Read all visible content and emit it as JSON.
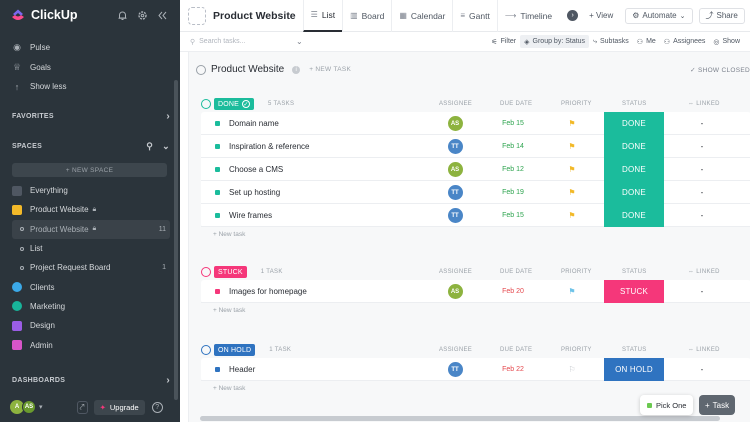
{
  "app": {
    "name": "ClickUp"
  },
  "sidebar": {
    "nav": [
      {
        "label": "Pulse",
        "icon": "pulse-icon"
      },
      {
        "label": "Goals",
        "icon": "trophy-icon"
      },
      {
        "label": "Show less",
        "icon": "arrow-up-icon"
      }
    ],
    "favorites_label": "FAVORITES",
    "spaces_label": "SPACES",
    "new_space_label": "+ NEW SPACE",
    "tree": [
      {
        "label": "Everything",
        "color": "#7c828d",
        "level": 0
      },
      {
        "label": "Product Website",
        "color": "#f2b929",
        "level": 0,
        "locked": true
      },
      {
        "label": "Product Website",
        "level": 1,
        "count": "11",
        "active": true,
        "locked": true
      },
      {
        "label": "List",
        "level": 1
      },
      {
        "label": "Project Request Board",
        "level": 1,
        "count": "1"
      },
      {
        "label": "Clients",
        "color": "#3ba9e8",
        "level": 0
      },
      {
        "label": "Marketing",
        "color": "#18b49a",
        "level": 0
      },
      {
        "label": "Design",
        "color": "#9b5de5",
        "level": 0
      },
      {
        "label": "Admin",
        "color": "#d855c9",
        "level": 0
      }
    ],
    "dashboards_label": "DASHBOARDS",
    "user_initials": [
      "A",
      "AS"
    ],
    "upgrade_label": "Upgrade"
  },
  "topbar": {
    "page_title": "Product Website",
    "views": [
      "List",
      "Board",
      "Calendar",
      "Gantt",
      "Timeline"
    ],
    "active_view": "List",
    "add_view_label": "+ View",
    "automate_label": "Automate",
    "share_label": "Share"
  },
  "filterbar": {
    "search_placeholder": "Search tasks...",
    "filter_label": "Filter",
    "groupby_label": "Group by: Status",
    "subtasks_label": "Subtasks",
    "me_label": "Me",
    "assignees_label": "Assignees",
    "show_label": "Show"
  },
  "list": {
    "title": "Product Website",
    "new_task_label": "+ NEW TASK",
    "show_closed_label": "SHOW CLOSED",
    "columns": {
      "assignee": "ASSIGNEE",
      "due": "DUE DATE",
      "priority": "PRIORITY",
      "status": "STATUS",
      "linked": "LINKED"
    },
    "add_task_label": "+ New task",
    "groups": [
      {
        "status": "DONE",
        "color": "#1bbc9c",
        "count_label": "5 TASKS",
        "tasks": [
          {
            "name": "Domain name",
            "assignee": "AS",
            "assignee_color": "#8db33f",
            "due": "Feb 15",
            "due_color": "#2ea44f",
            "priority_color": "#f2b929",
            "linked": "-"
          },
          {
            "name": "Inspiration & reference",
            "assignee": "TT",
            "assignee_color": "#4a86c7",
            "due": "Feb 14",
            "due_color": "#2ea44f",
            "priority_color": "#f2b929",
            "linked": "-"
          },
          {
            "name": "Choose a CMS",
            "assignee": "AS",
            "assignee_color": "#8db33f",
            "due": "Feb 12",
            "due_color": "#2ea44f",
            "priority_color": "#f2b929",
            "linked": "-"
          },
          {
            "name": "Set up hosting",
            "assignee": "TT",
            "assignee_color": "#4a86c7",
            "due": "Feb 19",
            "due_color": "#2ea44f",
            "priority_color": "#f2b929",
            "linked": "-"
          },
          {
            "name": "Wire frames",
            "assignee": "TT",
            "assignee_color": "#4a86c7",
            "due": "Feb 15",
            "due_color": "#2ea44f",
            "priority_color": "#f2b929",
            "linked": "-"
          }
        ]
      },
      {
        "status": "STUCK",
        "color": "#f5377a",
        "count_label": "1 TASK",
        "tasks": [
          {
            "name": "Images for homepage",
            "assignee": "AS",
            "assignee_color": "#8db33f",
            "due": "Feb 20",
            "due_color": "#e5484d",
            "priority_color": "#6fc3e8",
            "linked": "-"
          }
        ]
      },
      {
        "status": "ON HOLD",
        "color": "#2f73c0",
        "count_label": "1 TASK",
        "tasks": [
          {
            "name": "Header",
            "assignee": "TT",
            "assignee_color": "#4a86c7",
            "due": "Feb 22",
            "due_color": "#e5484d",
            "priority_color": "#c7cbd0",
            "linked": "-"
          }
        ]
      }
    ]
  },
  "floating": {
    "pick_label": "Pick One",
    "task_label": "Task"
  }
}
